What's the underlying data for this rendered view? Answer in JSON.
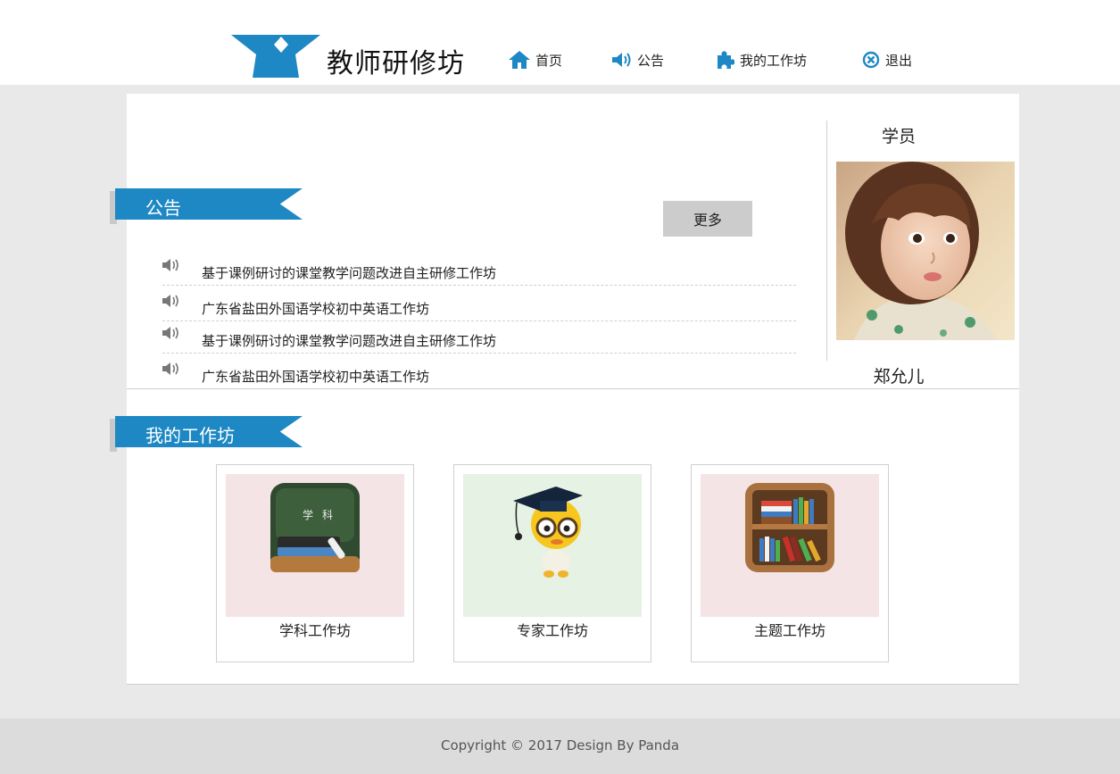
{
  "header": {
    "brand": "教师研修坊",
    "nav": {
      "home": "首页",
      "notice": "公告",
      "workshop": "我的工作坊",
      "logout": "退出"
    }
  },
  "notices": {
    "heading": "公告",
    "more_label": "更多",
    "items": [
      "基于课例研讨的课堂教学问题改进自主研修工作坊",
      "广东省盐田外国语学校初中英语工作坊",
      "基于课例研讨的课堂教学问题改进自主研修工作坊",
      "广东省盐田外国语学校初中英语工作坊"
    ]
  },
  "profile": {
    "role": "学员",
    "name": "郑允儿"
  },
  "workshops": {
    "heading": "我的工作坊",
    "cards": [
      {
        "label": "学科工作坊",
        "icon_text_1": "学",
        "icon_text_2": "科"
      },
      {
        "label": "专家工作坊"
      },
      {
        "label": "主题工作坊"
      }
    ]
  },
  "footer": {
    "copyright": "Copyright © 2017 Design By Panda"
  },
  "colors": {
    "accent": "#1e88c4",
    "page_bg": "#e8e9e8",
    "footer_bg": "#dcdcdc",
    "card_pink": "#f4e4e5",
    "card_green": "#e5f2e4"
  }
}
